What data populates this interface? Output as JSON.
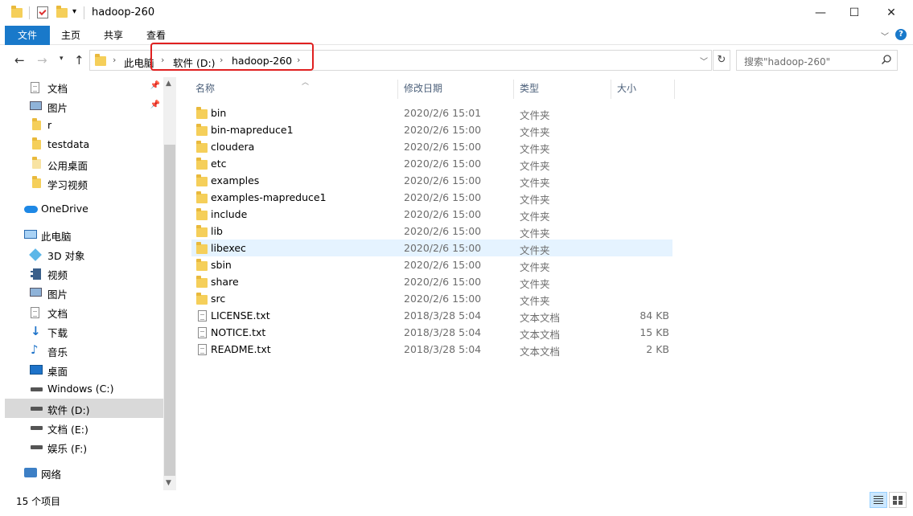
{
  "window": {
    "title": "hadoop-260",
    "minimize_glyph": "—",
    "maximize_glyph": "☐",
    "close_glyph": "✕"
  },
  "ribbon": {
    "tabs": [
      "文件",
      "主页",
      "共享",
      "查看"
    ]
  },
  "navigation": {
    "breadcrumbs": [
      "此电脑",
      "软件 (D:)",
      "hadoop-260"
    ],
    "search_placeholder": "搜索\"hadoop-260\""
  },
  "sidebar": {
    "items": [
      {
        "label": "文档",
        "icon": "document-icon",
        "pinned": true
      },
      {
        "label": "图片",
        "icon": "pictures-icon",
        "pinned": true
      },
      {
        "label": "r",
        "icon": "folder-icon"
      },
      {
        "label": "testdata",
        "icon": "folder-icon"
      },
      {
        "label": "公用桌面",
        "icon": "folder-icon"
      },
      {
        "label": "学习视频",
        "icon": "folder-icon"
      },
      {
        "label": "OneDrive",
        "icon": "cloud-icon"
      },
      {
        "label": "此电脑",
        "icon": "computer-icon"
      },
      {
        "label": "3D 对象",
        "icon": "cube-icon"
      },
      {
        "label": "视频",
        "icon": "video-icon"
      },
      {
        "label": "图片",
        "icon": "pictures-icon"
      },
      {
        "label": "文档",
        "icon": "document-icon"
      },
      {
        "label": "下载",
        "icon": "download-icon"
      },
      {
        "label": "音乐",
        "icon": "music-icon"
      },
      {
        "label": "桌面",
        "icon": "desktop-icon"
      },
      {
        "label": "Windows (C:)",
        "icon": "drive-icon"
      },
      {
        "label": "软件 (D:)",
        "icon": "drive-icon",
        "selected": true
      },
      {
        "label": "文档 (E:)",
        "icon": "drive-icon"
      },
      {
        "label": "娱乐 (F:)",
        "icon": "drive-icon"
      },
      {
        "label": "网络",
        "icon": "network-icon"
      }
    ]
  },
  "file_list": {
    "columns": [
      "名称",
      "修改日期",
      "类型",
      "大小"
    ],
    "rows": [
      {
        "name": "bin",
        "date": "2020/2/6 15:01",
        "type": "文件夹",
        "size": "",
        "kind": "folder"
      },
      {
        "name": "bin-mapreduce1",
        "date": "2020/2/6 15:00",
        "type": "文件夹",
        "size": "",
        "kind": "folder"
      },
      {
        "name": "cloudera",
        "date": "2020/2/6 15:00",
        "type": "文件夹",
        "size": "",
        "kind": "folder"
      },
      {
        "name": "etc",
        "date": "2020/2/6 15:00",
        "type": "文件夹",
        "size": "",
        "kind": "folder"
      },
      {
        "name": "examples",
        "date": "2020/2/6 15:00",
        "type": "文件夹",
        "size": "",
        "kind": "folder"
      },
      {
        "name": "examples-mapreduce1",
        "date": "2020/2/6 15:00",
        "type": "文件夹",
        "size": "",
        "kind": "folder"
      },
      {
        "name": "include",
        "date": "2020/2/6 15:00",
        "type": "文件夹",
        "size": "",
        "kind": "folder"
      },
      {
        "name": "lib",
        "date": "2020/2/6 15:00",
        "type": "文件夹",
        "size": "",
        "kind": "folder"
      },
      {
        "name": "libexec",
        "date": "2020/2/6 15:00",
        "type": "文件夹",
        "size": "",
        "kind": "folder",
        "hover": true
      },
      {
        "name": "sbin",
        "date": "2020/2/6 15:00",
        "type": "文件夹",
        "size": "",
        "kind": "folder"
      },
      {
        "name": "share",
        "date": "2020/2/6 15:00",
        "type": "文件夹",
        "size": "",
        "kind": "folder"
      },
      {
        "name": "src",
        "date": "2020/2/6 15:00",
        "type": "文件夹",
        "size": "",
        "kind": "folder"
      },
      {
        "name": "LICENSE.txt",
        "date": "2018/3/28 5:04",
        "type": "文本文档",
        "size": "84 KB",
        "kind": "text"
      },
      {
        "name": "NOTICE.txt",
        "date": "2018/3/28 5:04",
        "type": "文本文档",
        "size": "15 KB",
        "kind": "text"
      },
      {
        "name": "README.txt",
        "date": "2018/3/28 5:04",
        "type": "文本文档",
        "size": "2 KB",
        "kind": "text"
      }
    ]
  },
  "status": {
    "item_count": "15 个项目"
  },
  "colors": {
    "accent": "#1979ca",
    "folder": "#f5cf5a",
    "highlight_box": "#e02020",
    "hover_row": "#e5f3ff",
    "selected_nav": "#d9d9d9"
  }
}
